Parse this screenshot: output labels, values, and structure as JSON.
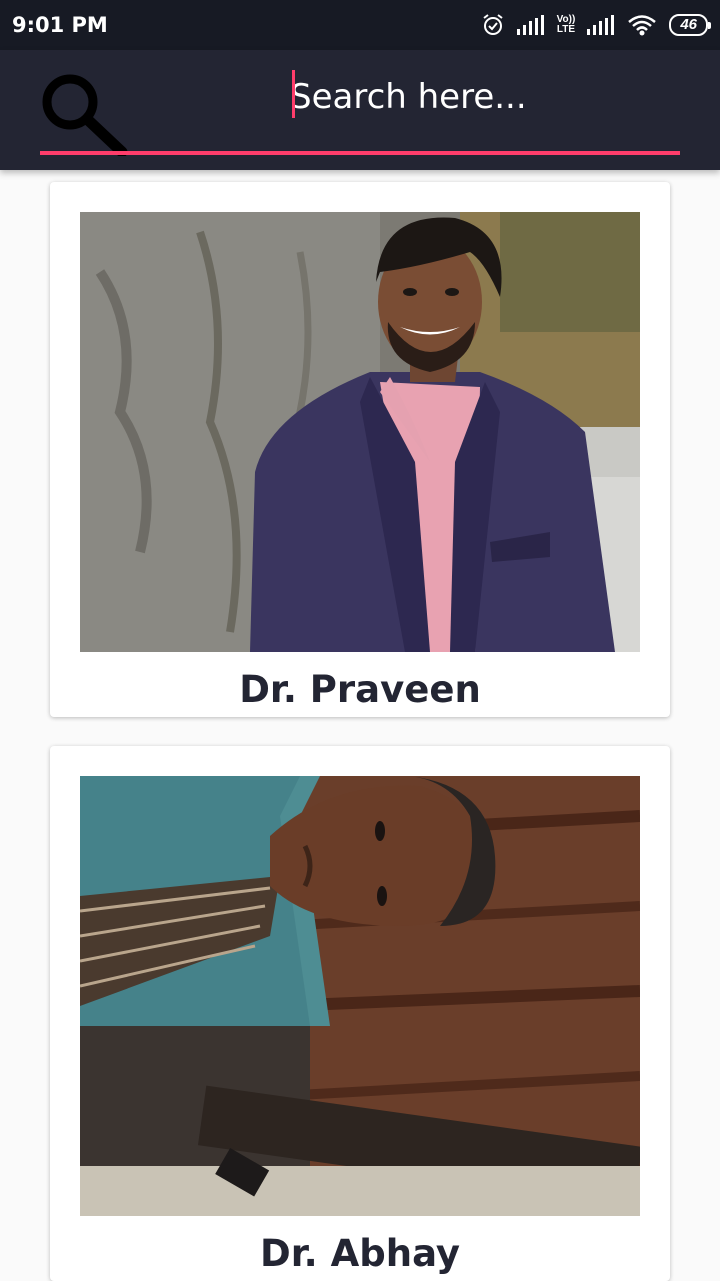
{
  "status_bar": {
    "time": "9:01 PM",
    "lte_top": "Vo))",
    "lte_bottom": "LTE",
    "battery": "46"
  },
  "search": {
    "placeholder": "Search here...",
    "value": ""
  },
  "colors": {
    "toolbar": "#232533",
    "accent": "#ff3d6b",
    "background": "#fafafa"
  },
  "doctors": [
    {
      "name": "Dr. Praveen",
      "photo": "portrait-praveen"
    },
    {
      "name": "Dr. Abhay",
      "photo": "portrait-abhay"
    }
  ]
}
